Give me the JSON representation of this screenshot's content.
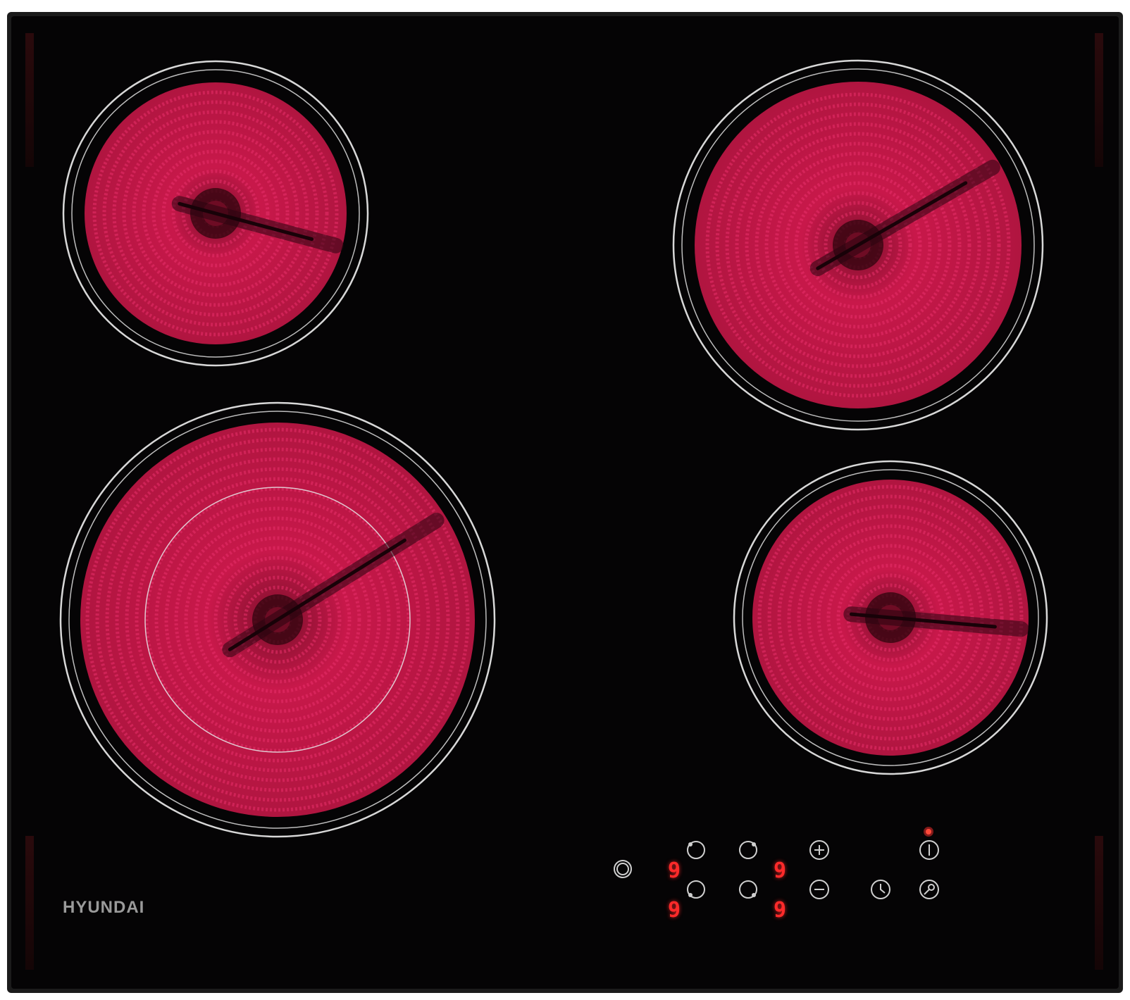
{
  "brand": {
    "name": "HYUNDAI"
  },
  "zones": [
    {
      "name": "rear-left",
      "display": "9"
    },
    {
      "name": "rear-right",
      "display": "9"
    },
    {
      "name": "front-left",
      "display": "9"
    },
    {
      "name": "front-right",
      "display": "9"
    }
  ],
  "controls": {
    "icons": [
      "power-icon",
      "plus-icon",
      "minus-icon",
      "timer-icon",
      "lock-icon",
      "dual-zone-icon"
    ],
    "power_indicator_on": true
  },
  "colors": {
    "glass": "#050405",
    "frame": "#1a1a1a",
    "heat": "#d01a4a",
    "ring": "#d8d8d8",
    "display": "#ff2a2a",
    "brand_text": "#9a9a9a"
  }
}
